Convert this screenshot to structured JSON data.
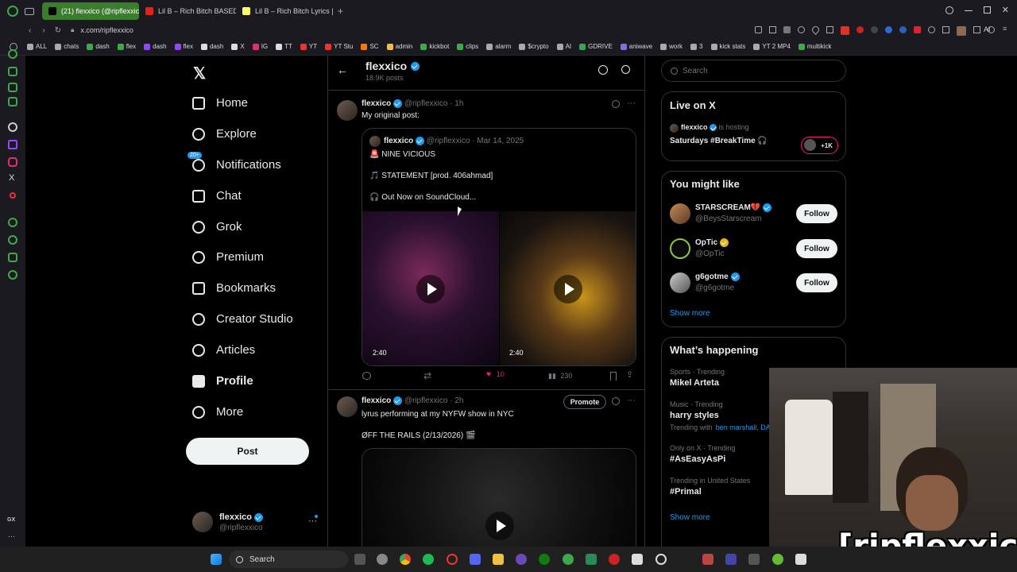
{
  "browser": {
    "tabs": [
      {
        "label": "(21) flexxico (@ripflexxico",
        "active": true
      },
      {
        "label": "Lil B – Rich Bitch BASED M",
        "active": false
      },
      {
        "label": "Lil B – Rich Bitch Lyrics | G",
        "active": false
      }
    ],
    "url": "x.com/ripflexxico",
    "ai_label": "AI",
    "bookmarks": [
      "ALL",
      "chats",
      "dash",
      "flex",
      "dash",
      "flex",
      "dash",
      "X",
      "IG",
      "TT",
      "YT",
      "YT Stu",
      "SC",
      "admin",
      "kickbot",
      "clips",
      "alarm",
      "$crypto",
      "AI",
      "GDRIVE",
      "aniwave",
      "work",
      "3",
      "kick stats",
      "YT 2 MP4",
      "multikick"
    ],
    "gx_label": "GX"
  },
  "nav": {
    "items": [
      {
        "label": "Home",
        "icon": "home-icon"
      },
      {
        "label": "Explore",
        "icon": "search-icon"
      },
      {
        "label": "Notifications",
        "icon": "bell-icon",
        "badge": "20+"
      },
      {
        "label": "Chat",
        "icon": "mail-icon"
      },
      {
        "label": "Grok",
        "icon": "grok-icon"
      },
      {
        "label": "Premium",
        "icon": "premium-icon"
      },
      {
        "label": "Bookmarks",
        "icon": "bookmark-icon"
      },
      {
        "label": "Creator Studio",
        "icon": "rocket-icon"
      },
      {
        "label": "Articles",
        "icon": "article-icon"
      },
      {
        "label": "Profile",
        "icon": "person-icon"
      },
      {
        "label": "More",
        "icon": "more-circle-icon"
      }
    ],
    "post_button": "Post",
    "account": {
      "name": "flexxico",
      "handle": "@ripflexxico",
      "more": "···"
    }
  },
  "header": {
    "name": "flexxico",
    "subtitle": "18.9K posts"
  },
  "posts": [
    {
      "name": "flexxico",
      "handle": "@ripflexxico",
      "time": "· 1h",
      "text": "My original post:",
      "quote": {
        "name": "flexxico",
        "handle": "@ripflexxico",
        "time": "· Mar 14, 2025",
        "lines": [
          "🚨 NINE VICIOUS",
          "🎵 STATEMENT [prod. 406ahmad]",
          "🎧 Out Now on SoundCloud..."
        ],
        "durations": [
          "2:40",
          "2:40"
        ]
      },
      "actions": {
        "likes": "10",
        "views": "230"
      }
    },
    {
      "name": "flexxico",
      "handle": "@ripflexxico",
      "time": "· 2h",
      "promote": "Promote",
      "lines": [
        "lyrus performing at my NYFW show in NYC",
        "ØFF THE RAILS (2/13/2026) 🎬"
      ]
    }
  ],
  "search": {
    "placeholder": "Search"
  },
  "live": {
    "title": "Live on X",
    "host": "flexxico",
    "hosting": "is hosting",
    "space": "Saturdays #BreakTime 🎧",
    "count": "+1K"
  },
  "suggestions": {
    "title": "You might like",
    "users": [
      {
        "name": "STARSCREAM💔",
        "handle": "@BeysStarscream",
        "follow": "Follow"
      },
      {
        "name": "OpTic",
        "handle": "@OpTic",
        "follow": "Follow"
      },
      {
        "name": "g6gotme",
        "handle": "@g6gotme",
        "follow": "Follow"
      }
    ],
    "show_more": "Show more"
  },
  "trends": {
    "title": "What’s happening",
    "items": [
      {
        "category": "Sports · Trending",
        "name": "Mikel Arteta"
      },
      {
        "category": "Music · Trending",
        "name": "harry styles",
        "extra_prefix": "Trending with",
        "extra_link": "ben marshall, DA"
      },
      {
        "category": "Only on X · Trending",
        "name": "#AsEasyAsPi"
      },
      {
        "category": "Trending in United States",
        "name": "#Primal"
      }
    ],
    "show_more": "Show more"
  },
  "overlay": {
    "name": "[ripflexxico]"
  },
  "taskbar": {
    "search": "Search"
  },
  "colors": {
    "accent": "#1d9bf0",
    "like": "#f91880",
    "opera_green": "#3a7d2d"
  }
}
